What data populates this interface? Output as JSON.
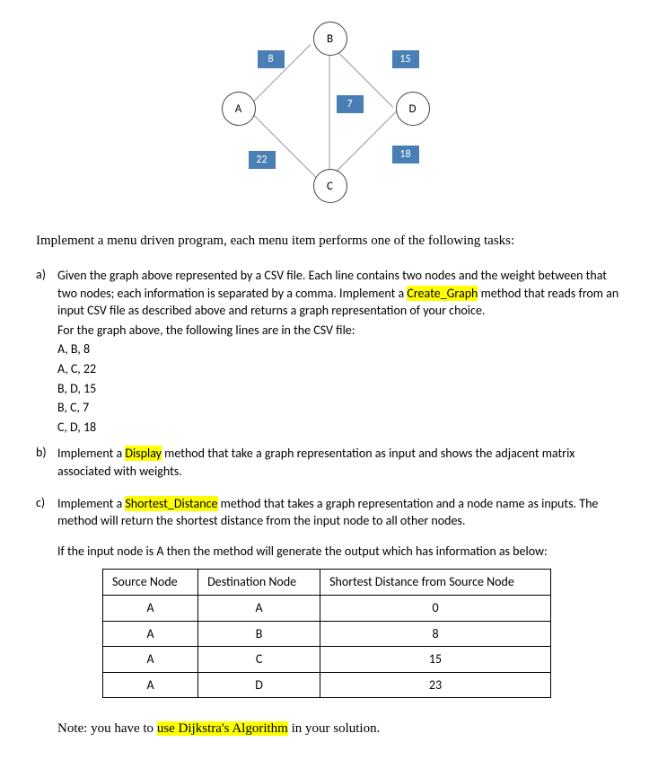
{
  "graph": {
    "nodes": {
      "A": "A",
      "B": "B",
      "C": "C",
      "D": "D"
    },
    "weights": {
      "AB": "8",
      "BD": "15",
      "BC": "7",
      "AC": "22",
      "CD": "18"
    }
  },
  "intro": "Implement a menu driven program, each menu item performs one of the following tasks:",
  "items": {
    "a": {
      "marker": "a)",
      "text_before": "Given the graph above represented by a CSV file. Each line contains two nodes and the weight between that two nodes; each information is separated by a comma. Implement a ",
      "highlight": "Create_Graph",
      "text_after": " method that reads from an input CSV file as described above and returns a graph representation of your choice.",
      "csv_intro": "For the graph above, the following lines are in the CSV file:",
      "csv": [
        "A, B, 8",
        "A, C, 22",
        "B, D, 15",
        "B, C, 7",
        "C, D, 18"
      ]
    },
    "b": {
      "marker": "b)",
      "text_before": "Implement a ",
      "highlight": "Display",
      "text_after": " method that take a graph representation as input and shows the adjacent matrix associated with weights."
    },
    "c": {
      "marker": "c)",
      "text_before": "Implement a ",
      "highlight": "Shortest_Distance",
      "text_after": " method that takes a graph representation and a node name as inputs. The method will return the shortest distance from the input node to all other nodes.",
      "sub": "If the input node is A then the method will generate the output which has information as below:"
    }
  },
  "table": {
    "headers": [
      "Source Node",
      "Destination Node",
      "Shortest Distance from Source Node"
    ],
    "rows": [
      [
        "A",
        "A",
        "0"
      ],
      [
        "A",
        "B",
        "8"
      ],
      [
        "A",
        "C",
        "15"
      ],
      [
        "A",
        "D",
        "23"
      ]
    ]
  },
  "note": {
    "before": "Note: you have to ",
    "highlight": "use Dijkstra's Algorithm",
    "after": " in your solution."
  }
}
